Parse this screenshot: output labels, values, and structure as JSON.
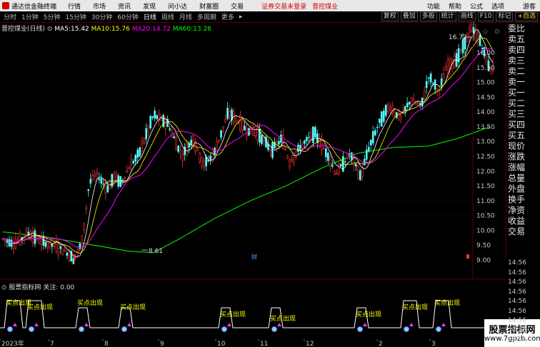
{
  "menubar": {
    "app_title": "通达信金融终端",
    "items": [
      "行情",
      "市场",
      "资讯",
      "发现",
      "问小达",
      "财富圈",
      "交易"
    ],
    "warning": "证券交易未登录",
    "stock": "晋控煤业",
    "right_items": [
      "功能",
      "帮助",
      "公式",
      "选项"
    ],
    "user": "游客"
  },
  "toolbar": {
    "periods": [
      "分时",
      "1分钟",
      "5分钟",
      "15分钟",
      "30分钟",
      "60分钟",
      "日线",
      "周线",
      "月线",
      "多周期",
      "更多"
    ],
    "active": "日线",
    "right_buttons": [
      "复权",
      "叠加",
      "多股",
      "统计",
      "画线",
      "F10",
      "标记",
      "+自选"
    ]
  },
  "ma_line": {
    "stock_label": "晋控煤业(日线)",
    "ma5_label": "MA5:",
    "ma5": "15.42",
    "ma10_label": "MA10:",
    "ma10": "15.76",
    "ma20_label": "MA20:",
    "ma20": "14.72",
    "ma60_label": "MA60:",
    "ma60": "13.26"
  },
  "price_axis": [
    "16.00",
    "15.50",
    "15.00",
    "14.50",
    "14.00",
    "13.50",
    "13.00",
    "12.50",
    "12.00",
    "11.50",
    "11.00",
    "10.50",
    "10.00",
    "9.50",
    "9.00"
  ],
  "annotations": {
    "high": "16.72",
    "low": "8.61"
  },
  "event_markers": [
    "财"
  ],
  "quote_panel": [
    "委比",
    "卖五",
    "卖四",
    "卖三",
    "卖二",
    "卖一",
    "买一",
    "买二",
    "买三",
    "买四",
    "买五",
    "现价",
    "涨跌",
    "涨幅",
    "总量",
    "外盘",
    "换手",
    "净资",
    "收益",
    "交易"
  ],
  "quote_right_axis": [
    "14:56",
    "14:56",
    "14:56",
    "14:56",
    "14:56",
    "14:56",
    "14:56",
    "14:56",
    "14:56"
  ],
  "indicator": {
    "name": "股票指标网",
    "focus_label": "关注:",
    "focus_value": "0.00",
    "signal_text": "买点出现"
  },
  "x_axis": {
    "labels": [
      "2023年",
      "7",
      "8",
      "9",
      "10",
      "11",
      "12",
      "2",
      "3"
    ]
  },
  "watermark": {
    "title": "股票指标网",
    "url": "www.7gpzb.com"
  },
  "colors": {
    "up": "#ff3232",
    "down": "#54ffff",
    "ma5": "#ffffff",
    "ma10": "#ffff00",
    "ma20": "#ff00ff",
    "ma60": "#00ff00",
    "signal": "#ffff00"
  }
}
